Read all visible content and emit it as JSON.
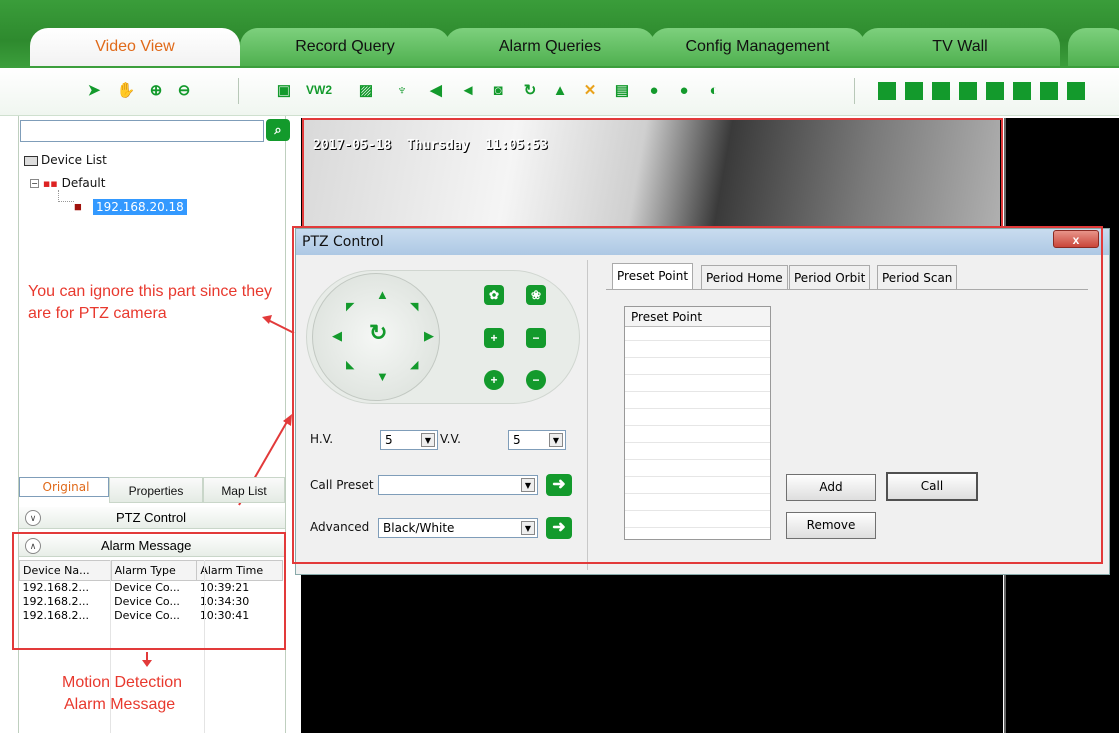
{
  "main_tabs": [
    {
      "label": "Video View",
      "active": true
    },
    {
      "label": "Record Query",
      "active": false
    },
    {
      "label": "Alarm Queries",
      "active": false
    },
    {
      "label": "Config Management",
      "active": false
    },
    {
      "label": "TV Wall",
      "active": false
    }
  ],
  "toolbar": {
    "left_icons": [
      "pointer-icon",
      "hand-icon",
      "zoom-in-icon",
      "zoom-out-icon"
    ],
    "middle_icons": [
      "fullscreen-icon",
      "vw2-icon",
      "snapshot-icon",
      "microphone-icon",
      "volume-icon",
      "speaker-icon",
      "record-icon",
      "refresh-icon",
      "alarm-bell-icon",
      "shrink-icon",
      "monitor-icon",
      "stop-icon",
      "record-circle-icon",
      "half-circle-icon"
    ],
    "vw2_label": "VW2",
    "layout_icons": [
      "layout-1-icon",
      "layout-4-icon",
      "layout-6-icon",
      "layout-8-icon",
      "layout-9-icon",
      "layout-13-icon",
      "layout-16-icon",
      "layout-25-icon"
    ]
  },
  "search": {
    "value": ""
  },
  "device_tree": {
    "root": "Device List",
    "group": "Default",
    "device": "192.168.20.18"
  },
  "annotations": {
    "ptz_note": "You can ignore this part since they are for PTZ camera",
    "motion_note_line1": "Motion Detection",
    "motion_note_line2": "Alarm Message"
  },
  "left_tabs": [
    {
      "label": "Original",
      "active": true
    },
    {
      "label": "Properties",
      "active": false
    },
    {
      "label": "Map List",
      "active": false
    }
  ],
  "ptz_section_label": "PTZ Control",
  "alarm_section_label": "Alarm Message",
  "alarm_table": {
    "headers": [
      "Device Na...",
      "Alarm Type",
      "Alarm Time"
    ],
    "rows": [
      [
        "192.168.2...",
        "Device Co...",
        "10:39:21"
      ],
      [
        "192.168.2...",
        "Device Co...",
        "10:34:30"
      ],
      [
        "192.168.2...",
        "Device Co...",
        "10:30:41"
      ]
    ]
  },
  "video": {
    "osd": "2017-05-18  Thursday  11:05:53"
  },
  "ptz_dialog": {
    "title": "PTZ Control",
    "close_label": "x",
    "hv_label": "H.V.",
    "hv_value": "5",
    "vv_label": "V.V.",
    "vv_value": "5",
    "call_preset_label": "Call Preset",
    "call_preset_value": "",
    "advanced_label": "Advanced",
    "advanced_value": "Black/White",
    "tabs": [
      "Preset Point",
      "Period Home",
      "Period Orbit",
      "Period Scan"
    ],
    "list_header": "Preset Point",
    "add_label": "Add",
    "call_label": "Call",
    "remove_label": "Remove"
  },
  "colors": {
    "accent_green": "#139a2c",
    "highlight_red": "#e23a3a",
    "active_tab_text": "#e06a1a"
  }
}
